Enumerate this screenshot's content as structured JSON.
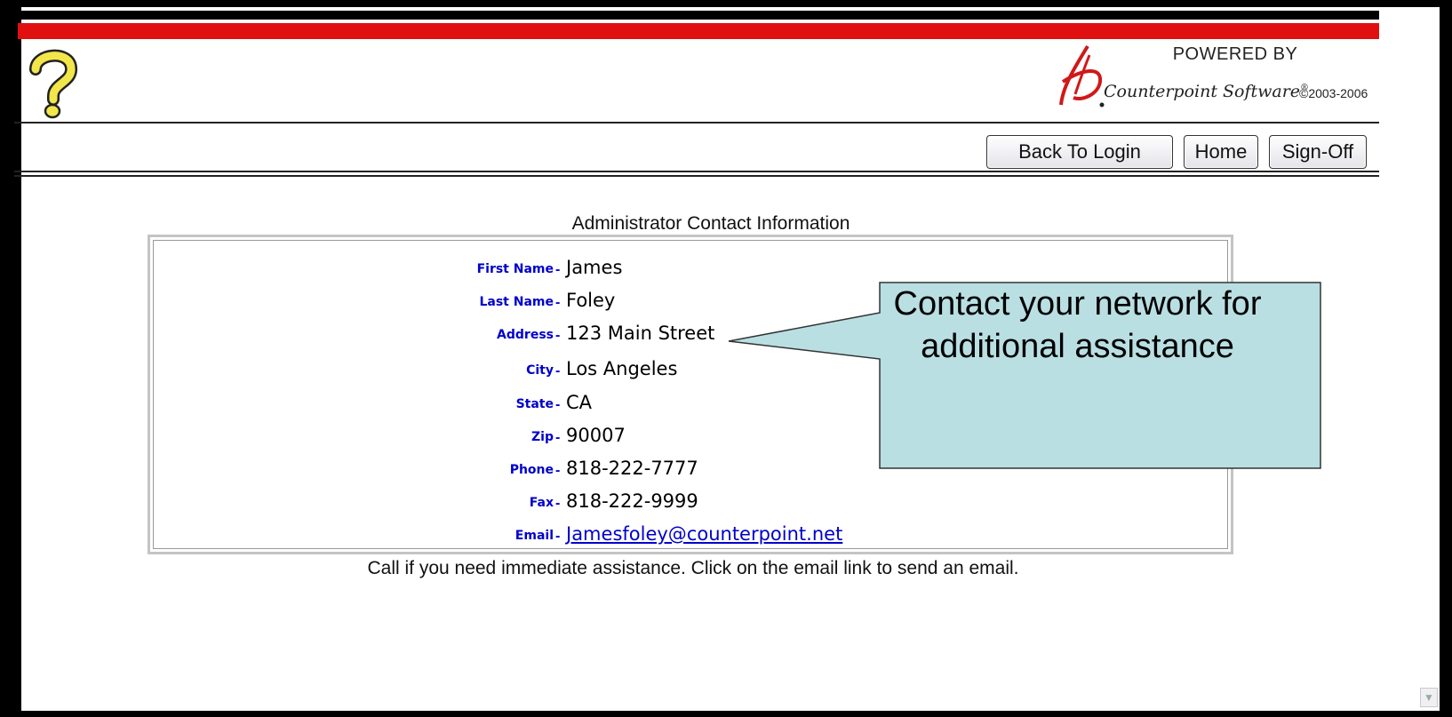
{
  "header": {
    "powered_by": "POWERED BY",
    "brand_name": "Counterpoint Software",
    "brand_trademark": "®",
    "copyright": "©2003-2006",
    "help_icon": "question-mark-icon",
    "colors": {
      "accent_red": "#e01010",
      "link_blue": "#0000cc"
    }
  },
  "nav": {
    "back_to_login": "Back To Login",
    "home": "Home",
    "sign_off": "Sign-Off"
  },
  "contact": {
    "title": "Administrator Contact Information",
    "fields": [
      {
        "label": "First Name",
        "value": "James"
      },
      {
        "label": "Last Name",
        "value": "Foley"
      },
      {
        "label": "Address",
        "value": "123 Main Street"
      },
      {
        "label": "City",
        "value": "Los Angeles"
      },
      {
        "label": "State",
        "value": "CA"
      },
      {
        "label": "Zip",
        "value": "90007"
      },
      {
        "label": "Phone",
        "value": "818-222-7777"
      },
      {
        "label": "Fax",
        "value": "818-222-9999"
      },
      {
        "label": "Email",
        "value": "Jamesfoley@counterpoint.net"
      }
    ],
    "footer_note": "Call if you need immediate assistance. Click on the email link to send an email."
  },
  "callout": {
    "text": "Contact your network for additional assistance",
    "fill": "#b9dfe3"
  }
}
